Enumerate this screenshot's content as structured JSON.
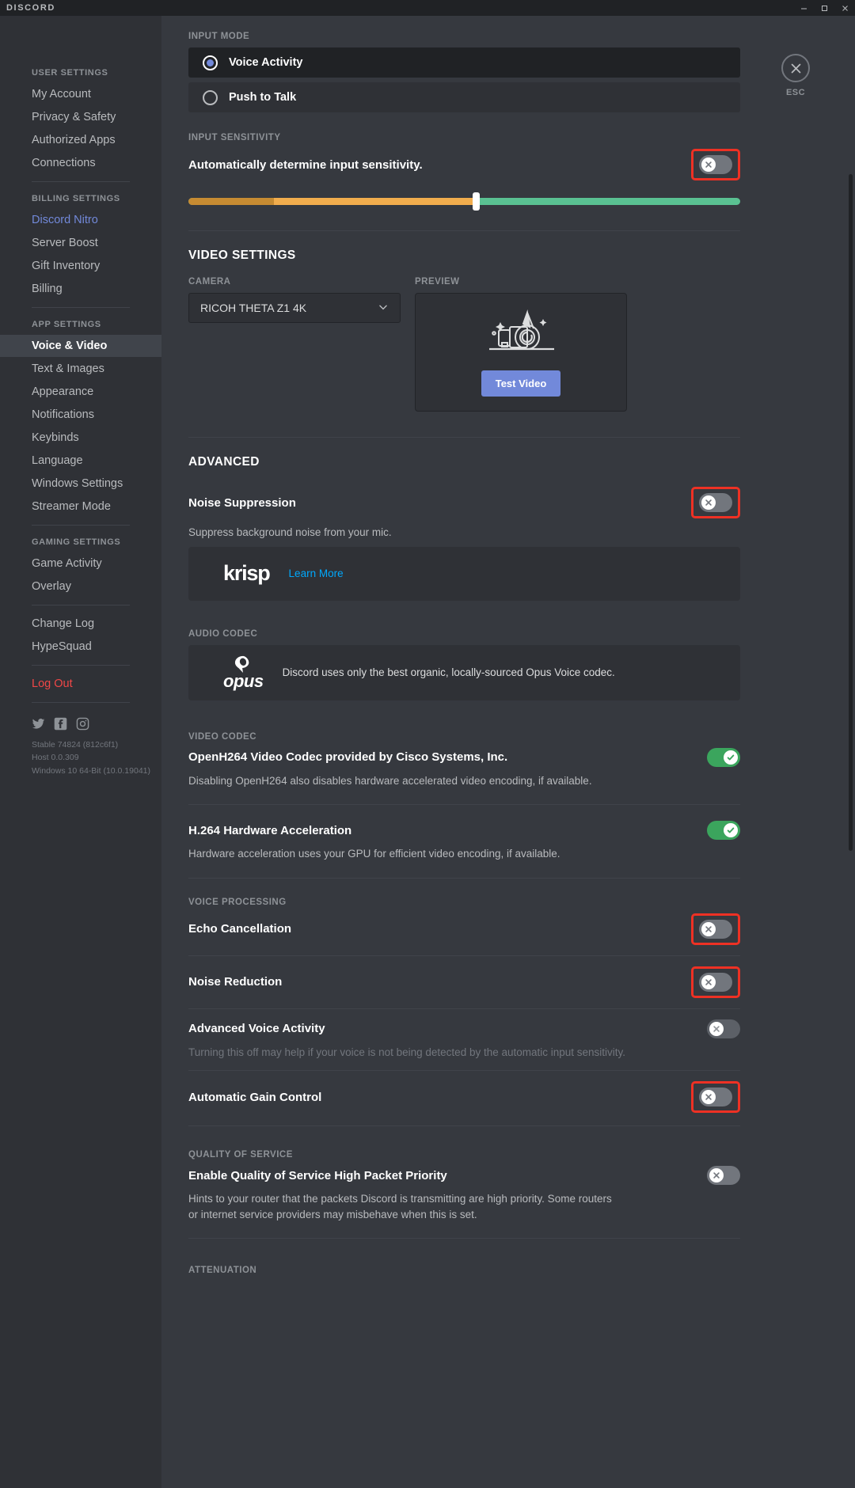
{
  "window": {
    "brand": "DISCORD",
    "controls": [
      "minimize",
      "maximize",
      "close"
    ]
  },
  "sidebar": {
    "groups": [
      {
        "heading": "USER SETTINGS",
        "items": [
          {
            "label": "My Account",
            "style": "normal"
          },
          {
            "label": "Privacy & Safety",
            "style": "normal"
          },
          {
            "label": "Authorized Apps",
            "style": "normal"
          },
          {
            "label": "Connections",
            "style": "normal"
          }
        ]
      },
      {
        "heading": "BILLING SETTINGS",
        "items": [
          {
            "label": "Discord Nitro",
            "style": "nitro"
          },
          {
            "label": "Server Boost",
            "style": "normal"
          },
          {
            "label": "Gift Inventory",
            "style": "normal"
          },
          {
            "label": "Billing",
            "style": "normal"
          }
        ]
      },
      {
        "heading": "APP SETTINGS",
        "items": [
          {
            "label": "Voice & Video",
            "style": "active"
          },
          {
            "label": "Text & Images",
            "style": "normal"
          },
          {
            "label": "Appearance",
            "style": "normal"
          },
          {
            "label": "Notifications",
            "style": "normal"
          },
          {
            "label": "Keybinds",
            "style": "normal"
          },
          {
            "label": "Language",
            "style": "normal"
          },
          {
            "label": "Windows Settings",
            "style": "normal"
          },
          {
            "label": "Streamer Mode",
            "style": "normal"
          }
        ]
      },
      {
        "heading": "GAMING SETTINGS",
        "items": [
          {
            "label": "Game Activity",
            "style": "normal"
          },
          {
            "label": "Overlay",
            "style": "normal"
          }
        ]
      },
      {
        "heading": "",
        "items": [
          {
            "label": "Change Log",
            "style": "normal"
          },
          {
            "label": "HypeSquad",
            "style": "normal"
          }
        ]
      },
      {
        "heading": "",
        "items": [
          {
            "label": "Log Out",
            "style": "logout"
          }
        ]
      }
    ],
    "socials": [
      "twitter-icon",
      "facebook-icon",
      "instagram-icon"
    ],
    "version": {
      "build": "Stable 74824 (812c6f1)",
      "host": "Host 0.0.309",
      "os": "Windows 10 64-Bit (10.0.19041)"
    }
  },
  "close": {
    "icon": "close-icon",
    "label": "ESC"
  },
  "main": {
    "input_mode": {
      "heading": "INPUT MODE",
      "options": [
        {
          "label": "Voice Activity",
          "selected": true
        },
        {
          "label": "Push to Talk",
          "selected": false
        }
      ]
    },
    "input_sensitivity": {
      "heading": "INPUT SENSITIVITY",
      "title": "Automatically determine input sensitivity.",
      "toggle_on": false,
      "toggle_highlighted": true,
      "slider_value": 52
    },
    "video_settings": {
      "heading": "VIDEO SETTINGS",
      "camera_label": "CAMERA",
      "camera_value": "RICOH THETA Z1 4K",
      "preview_label": "PREVIEW",
      "preview_icon": "camera-illustration",
      "test_video_button": "Test Video"
    },
    "advanced": {
      "heading": "ADVANCED",
      "noise_suppression": {
        "title": "Noise Suppression",
        "desc": "Suppress background noise from your mic.",
        "toggle_on": false,
        "toggle_highlighted": true
      },
      "krisp_card": {
        "logo": "krisp",
        "link": "Learn More"
      }
    },
    "audio_codec": {
      "heading": "AUDIO CODEC",
      "logo": "opus",
      "text": "Discord uses only the best organic, locally-sourced Opus Voice codec."
    },
    "video_codec": {
      "heading": "VIDEO CODEC",
      "rows": [
        {
          "title": "OpenH264 Video Codec provided by Cisco Systems, Inc.",
          "desc": "Disabling OpenH264 also disables hardware accelerated video encoding, if available.",
          "toggle_on": true,
          "toggle_highlighted": false
        },
        {
          "title": "H.264 Hardware Acceleration",
          "desc": "Hardware acceleration uses your GPU for efficient video encoding, if available.",
          "toggle_on": true,
          "toggle_highlighted": false
        }
      ]
    },
    "voice_processing": {
      "heading": "VOICE PROCESSING",
      "rows": [
        {
          "title": "Echo Cancellation",
          "desc": "",
          "toggle_on": false,
          "toggle_highlighted": true,
          "dimmed": false
        },
        {
          "title": "Noise Reduction",
          "desc": "",
          "toggle_on": false,
          "toggle_highlighted": true,
          "dimmed": false
        },
        {
          "title": "Advanced Voice Activity",
          "desc": "Turning this off may help if your voice is not being detected by the automatic input sensitivity.",
          "toggle_on": false,
          "toggle_highlighted": false,
          "dimmed": true
        },
        {
          "title": "Automatic Gain Control",
          "desc": "",
          "toggle_on": false,
          "toggle_highlighted": true,
          "dimmed": false
        }
      ]
    },
    "quality_of_service": {
      "heading": "QUALITY OF SERVICE",
      "title": "Enable Quality of Service High Packet Priority",
      "desc": "Hints to your router that the packets Discord is transmitting are high priority. Some routers or internet service providers may misbehave when this is set.",
      "toggle_on": false,
      "toggle_highlighted": false
    },
    "attenuation": {
      "heading": "ATTENUATION"
    }
  },
  "colors": {
    "accent": "#7289da",
    "toggle_on": "#3ba55d",
    "toggle_off": "#72767d",
    "highlight_box": "#ee3124",
    "link": "#00a8fc",
    "nitro": "#7289da",
    "logout": "#f04747"
  }
}
